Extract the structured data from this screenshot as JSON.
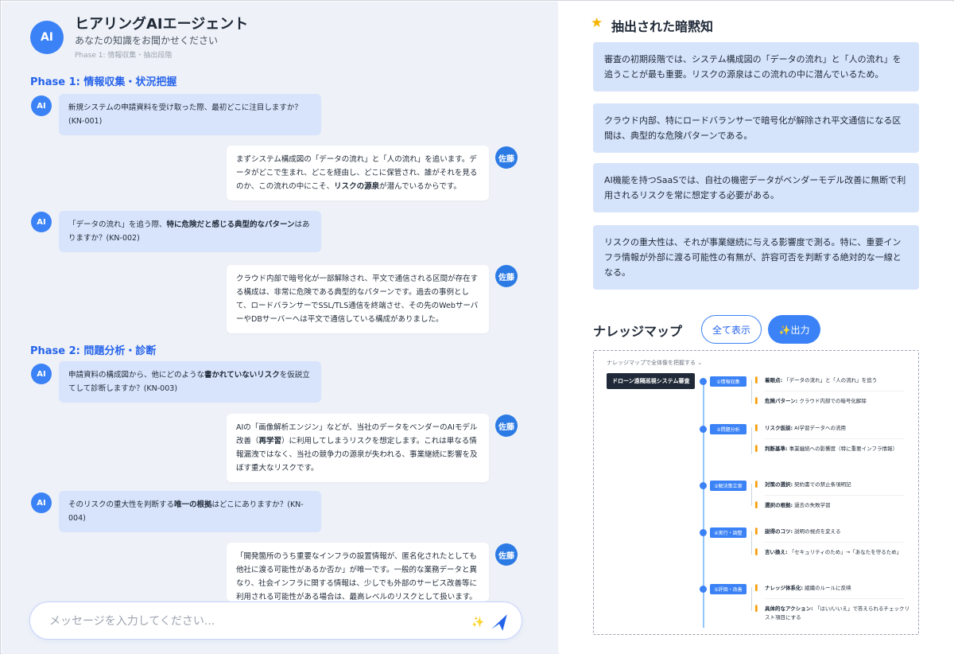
{
  "chat": {
    "avatar": "AI",
    "title": "ヒアリングAIエージェント",
    "subtitle": "あなたの知識をお聞かせください",
    "phase_label": "Phase 1: 情報収集・抽出段階",
    "user_avatar": "佐藤",
    "phase1_heading": "Phase 1: 情報収集・状況把握",
    "phase2_heading": "Phase 2: 問題分析・診断",
    "q1": "新規システムの申請資料を受け取った際、最初どこに注目しますか？(KN-001)",
    "a1_pre": "まずシステム構成図の「データの流れ」と「人の流れ」を追います。データがどこで生まれ、どこを経由し、どこに保管され、誰がそれを見るのか、この流れの中にこそ、",
    "a1_bold": "リスクの源泉",
    "a1_post": "が潜んでいるからです。",
    "q2_pre": "「データの流れ」を追う際、",
    "q2_bold": "特に危険だと感じる典型的なパターン",
    "q2_post": "はありますか？(KN-002)",
    "a2": "クラウド内部で暗号化が一部解除され、平文で通信される区間が存在する構成は、非常に危険である典型的なパターンです。過去の事例として、ロードバランサーでSSL/TLS通信を終端させ、その先のWebサーバーやDBサーバーへは平文で通信している構成がありました。",
    "q3_pre": "申請資料の構成図から、他にどのような",
    "q3_bold": "書かれていないリスク",
    "q3_post": "を仮説立てして診断しますか？(KN-003)",
    "a3_pre": "AIの「画像解析エンジン」などが、当社のデータをベンダーのAIモデル改善（",
    "a3_bold": "再学習",
    "a3_post": "）に利用してしまうリスクを想定します。これは単なる情報漏洩ではなく、当社の競争力の源泉が失われる、事業継続に影響を及ぼす重大なリスクです。",
    "q4_pre": "そのリスクの重大性を判断する",
    "q4_bold": "唯一の根拠",
    "q4_post": "はどこにありますか？(KN-004)",
    "a4": "「開発箇所のうち重要なインフラの設置情報が、匿名化されたとしても他社に渡る可能性があるか否か」が唯一です。一般的な業務データと異なり、社会インフラに関する情報は、少しでも外部のサービス改善等に利用される可能性がある場合は、最高レベルのリスクとして扱います。",
    "input_placeholder": "メッセージを入力してください..."
  },
  "knowledge": {
    "title": "抽出された暗黙知",
    "cards": [
      "審査の初期段階では、システム構成図の「データの流れ」と「人の流れ」を追うことが最も重要。リスクの源泉はこの流れの中に潜んでいるため。",
      "クラウド内部、特にロードバランサーで暗号化が解除され平文通信になる区間は、典型的な危険パターンである。",
      "AI機能を持つSaaSでは、自社の機密データがベンダーモデル改善に無断で利用されるリスクを常に想定する必要がある。",
      "リスクの重大性は、それが事業継続に与える影響度で測る。特に、重要インフラ情報が外部に渡る可能性の有無が、許容可否を判断する絶対的な一線となる。"
    ]
  },
  "knowledge_map": {
    "title": "ナレッジマップ",
    "show_all_label": "全て表示",
    "output_label": "✨出力",
    "hint": "ナレッジマップで全体像を把握する ⌄",
    "root": "ドローン遠隔巡視システム審査",
    "nodes": [
      {
        "label": "①情報収集",
        "leaves": [
          {
            "k": "着眼点:",
            "v": " 「データの流れ」と「人の流れ」を追う"
          },
          {
            "k": "危険パターン:",
            "v": " クラウド内部での暗号化解除"
          }
        ]
      },
      {
        "label": "②問題分析",
        "leaves": [
          {
            "k": "リスク仮説:",
            "v": " AI学習データへの流用"
          },
          {
            "k": "判断基準:",
            "v": " 事業継続への影響度（特に重要インフラ情報）"
          }
        ]
      },
      {
        "label": "③解決策立案",
        "leaves": [
          {
            "k": "対策の選択:",
            "v": " 契約書での禁止条項明記"
          },
          {
            "k": "選択の根拠:",
            "v": " 過去の失敗学習"
          }
        ]
      },
      {
        "label": "④実行・調整",
        "leaves": [
          {
            "k": "説得のコツ:",
            "v": " 説明の視点を変える"
          },
          {
            "k": "言い換え:",
            "v": " 「セキュリティのため」→「あなたを守るため」"
          }
        ]
      },
      {
        "label": "⑤評価・改善",
        "leaves": [
          {
            "k": "ナレッジ体系化:",
            "v": " 組織のルールに反映"
          },
          {
            "k": "具体的なアクション:",
            "v": " 「はい/いいえ」で答えられるチェックリスト項目にする"
          }
        ]
      }
    ]
  },
  "colors": {
    "accent": "#3b82f6",
    "ai_bubble": "#d7e4fb",
    "card": "#d5e3fb",
    "star": "#f5b301"
  },
  "icons": {
    "send": "send-arrow-icon",
    "sparkle": "sparkle-icon",
    "star": "star-icon"
  }
}
